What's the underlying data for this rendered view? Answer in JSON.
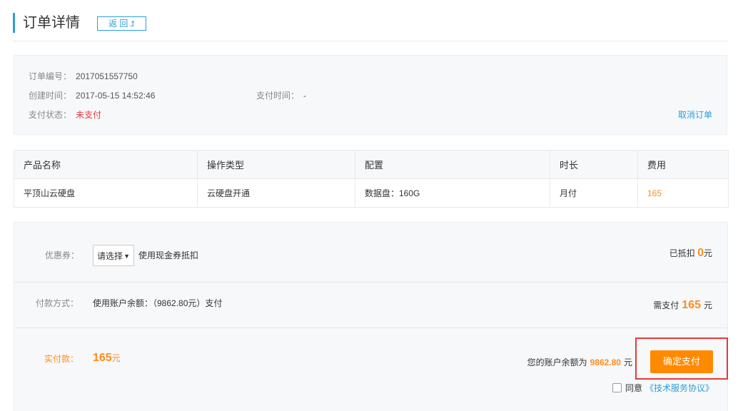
{
  "header": {
    "title": "订单详情",
    "back_label": "返 回",
    "back_icon": "return-arrow-icon"
  },
  "order_info": {
    "order_no_label": "订单编号：",
    "order_no": "2017051557750",
    "created_label": "创建时间：",
    "created": "2017-05-15 14:52:46",
    "pay_time_label": "支付时间：",
    "pay_time": "-",
    "status_label": "支付状态：",
    "status": "未支付",
    "cancel_label": "取消订单"
  },
  "product_table": {
    "columns": [
      "产品名称",
      "操作类型",
      "配置",
      "时长",
      "费用"
    ],
    "rows": [
      [
        "平顶山云硬盘",
        "云硬盘开通",
        "数据盘：160G",
        "月付",
        "165"
      ]
    ]
  },
  "payment": {
    "coupon_label": "优惠券：",
    "coupon_selected": "请选择",
    "coupon_hint": "使用现金券抵扣",
    "deducted_prefix": "已抵扣",
    "deducted_amount": "0",
    "deducted_unit": "元",
    "method_label": "付款方式：",
    "method_value": "使用账户余额：（9862.80元）支付",
    "need_prefix": "需支付",
    "need_amount": "165",
    "need_unit": "元",
    "actual_label": "实付款：",
    "actual_amount": "165",
    "actual_unit": "元",
    "balance_prefix": "您的账户余额为",
    "balance_amount": "9862.80",
    "balance_unit": "元",
    "confirm_label": "确定支付",
    "agree_label": "同意",
    "agreement_link": "《技术服务协议》"
  },
  "colors": {
    "accent": "#2a9fd6",
    "price": "#ff8c1a",
    "confirm_button": "#ff8a00",
    "status_unpaid": "#e4393c",
    "highlight": "#e4393c"
  }
}
